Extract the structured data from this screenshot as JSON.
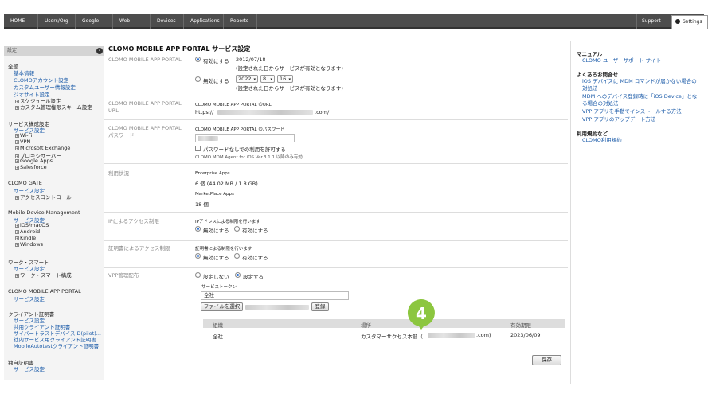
{
  "topnav": {
    "items": [
      "HOME",
      "Users/Org",
      "Google Apps",
      "Web Access",
      "Devices",
      "Applications",
      "Reports"
    ],
    "support": "Support",
    "settings": "Settings"
  },
  "sidebar": {
    "header": "設定",
    "sections": [
      {
        "title": "全般",
        "links": [
          "基本情報",
          "CLOMOアカウント設定",
          "カスタムユーザー情報設定",
          "ジオサイト設定"
        ],
        "subs": [
          "スケジュール設定",
          "カスタム管理権限スキーム設定"
        ]
      },
      {
        "title": "サービス構成設定",
        "links": [
          "サービス設定"
        ],
        "subs": [
          "Wi-Fi",
          "VPN",
          "Microsoft Exchange",
          "プロキシサーバー",
          "Google Apps",
          "Salesforce"
        ]
      },
      {
        "title": "CLOMO GATE",
        "links": [
          "サービス設定"
        ],
        "subs": [
          "アクセスコントロール"
        ]
      },
      {
        "title": "Mobile Device Management",
        "links": [
          "サービス設定"
        ],
        "subs": [
          "iOS/macOS",
          "Android",
          "Kindle",
          "Windows"
        ]
      },
      {
        "title": "ワーク・スマート",
        "links": [
          "サービス設定"
        ],
        "subs": [
          "ワーク・スマート構成"
        ]
      },
      {
        "title": "CLOMO MOBILE APP PORTAL",
        "links": [
          "サービス設定"
        ],
        "subs": []
      },
      {
        "title": "クライアント証明書",
        "links": [
          "サービス設定",
          "共用クライアント証明書",
          "サイバートラストデバイスID(pilot)...",
          "社内サービス用クライアント証明書",
          "MobileAutotestクライアント証明書"
        ],
        "subs": []
      },
      {
        "title": "独自証明書",
        "links": [
          "サービス設定"
        ],
        "subs": []
      }
    ]
  },
  "main": {
    "title": "CLOMO MOBILE APP PORTAL サービス設定",
    "portal": {
      "label": "CLOMO MOBILE APP PORTAL",
      "enable_label": "有効にする",
      "enable_date": "2012/07/18",
      "enable_note": "(設定された日からサービスが有効となります)",
      "disable_label": "無効にする",
      "year": "2022",
      "month": "8",
      "day": "16",
      "disable_note": "(設定された日からサービスが有効となります)"
    },
    "url": {
      "label": "CLOMO MOBILE APP PORTAL URL",
      "caption": "CLOMO MOBILE APP PORTAL のURL",
      "prefix": "https://",
      "suffix": ".com/"
    },
    "password": {
      "label": "CLOMO MOBILE APP PORTAL パスワード",
      "caption": "CLOMO MOBILE APP PORTAL のパスワード",
      "checkbox_label": "パスワードなしでの利用を許可する",
      "note": "CLOMO MDM Agent for iOS Ver.3.1.1 以降のみ有効"
    },
    "usage": {
      "label": "利用状況",
      "enterprise_title": "Enterprise Apps",
      "enterprise_value": "6 個 (44.02 MB / 1.8 GB)",
      "marketplace_title": "MarketPlace Apps",
      "marketplace_value": "18 個"
    },
    "ip": {
      "label": "IPによるアクセス制限",
      "caption": "IPアドレスによる制限を行います",
      "disable": "無効にする",
      "enable": "有効にする"
    },
    "cert": {
      "label": "証明書によるアクセス制限",
      "caption": "証明書による制限を行います",
      "disable": "無効にする",
      "enable": "有効にする"
    },
    "vpp": {
      "label": "VPP管理配布",
      "no_setting": "設定しない",
      "setting": "設定する",
      "token_caption": "サービストークン",
      "token_value": "全社",
      "file_button": "ファイルを選択",
      "register_button": "登録",
      "table_headers": [
        "組織",
        "場所",
        "有効期限"
      ],
      "table_rows": [
        [
          "全社",
          "カスタマーサクセス本部（",
          ".com)",
          "2023/06/09"
        ]
      ]
    },
    "save_button": "保存",
    "step_number": "4"
  },
  "rightpanel": {
    "manual_title": "マニュアル",
    "manual_links": [
      "CLOMO ユーザーサポート サイト"
    ],
    "faq_title": "よくあるお問合せ",
    "faq_links": [
      "iOS デバイスに MDM コマンドが届かない場合の対処法",
      "MDM へのデバイス登録時に「iOS Device」となる場合の対処法",
      "VPP アプリを手動でインストールする方法",
      "VPP アプリのアップデート方法"
    ],
    "terms_title": "利用規約など",
    "terms_links": [
      "CLOMO利用規約"
    ]
  },
  "colors": {
    "accent_green": "#8cc63f",
    "nav_bg": "#4d4d4d",
    "link": "#1a5aa8"
  }
}
